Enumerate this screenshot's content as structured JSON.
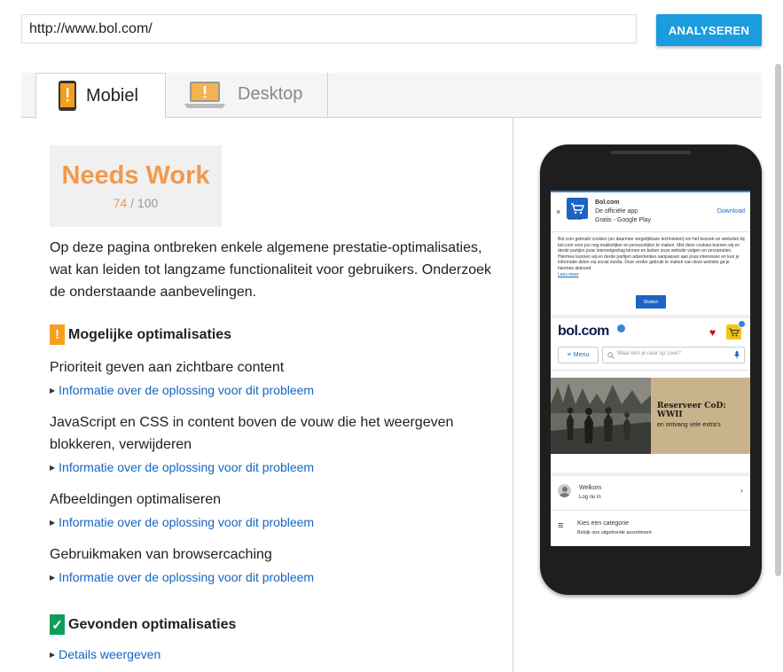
{
  "url": "http://www.bol.com/",
  "analyze_label": "ANALYSEREN",
  "tabs": {
    "mobile": "Mobiel",
    "desktop": "Desktop"
  },
  "score": {
    "label": "Needs Work",
    "value": "74",
    "max": "/ 100",
    "color": "#f2994a"
  },
  "summary": "Op deze pagina ontbreken enkele algemene prestatie-optimalisaties, wat kan leiden tot langzame functionaliteit voor gebruikers. Onderzoek de onderstaande aanbevelingen.",
  "possible": {
    "heading": "Mogelijke optimalisaties",
    "badge": "!",
    "items": [
      {
        "title": "Prioriteit geven aan zichtbare content",
        "link": "Informatie over de oplossing voor dit probleem"
      },
      {
        "title": "JavaScript en CSS in content boven de vouw die het weergeven blokkeren, verwijderen",
        "link": "Informatie over de oplossing voor dit probleem"
      },
      {
        "title": "Afbeeldingen optimaliseren",
        "link": "Informatie over de oplossing voor dit probleem"
      },
      {
        "title": "Gebruikmaken van browsercaching",
        "link": "Informatie over de oplossing voor dit probleem"
      }
    ]
  },
  "found": {
    "heading": "Gevonden optimalisaties",
    "badge": "✓",
    "link": "Details weergeven"
  },
  "phone": {
    "app_name": "Bol.com",
    "app_desc1": "De officiële app",
    "app_desc2": "Gratis - Google Play",
    "download": "Download",
    "close": "×",
    "cookie_text": "Bol.com gebruikt cookies (en daarmee vergelijkbare technieken) om het bezoek en winkelen bij bol.com voor jou nog makkelijker en persoonlijker te maken. Met deze cookies kunnen wij en derde partijen jouw internetgedrag binnen en buiten onze website volgen en verzamelen. Hiermee kunnen wij en derde partijen advertenties aanpassen aan jouw interesses en kun je informatie delen via social media. Door verder gebruik te maken van deze website ga je hiermee akkoord.",
    "cookie_link": "Lees meer",
    "close_btn": "Sluiten",
    "logo": "bol.com",
    "menu": "Menu",
    "search_placeholder": "Waar ben je naar op zoek?",
    "banner_title": "Reserveer CoD: WWII",
    "banner_sub": "en ontvang vele extra's",
    "welcome": "Welkom",
    "login": "Log nu in",
    "category": "Kies een categorie",
    "category_sub": "Bekijk ons uitgebreide assortiment"
  }
}
